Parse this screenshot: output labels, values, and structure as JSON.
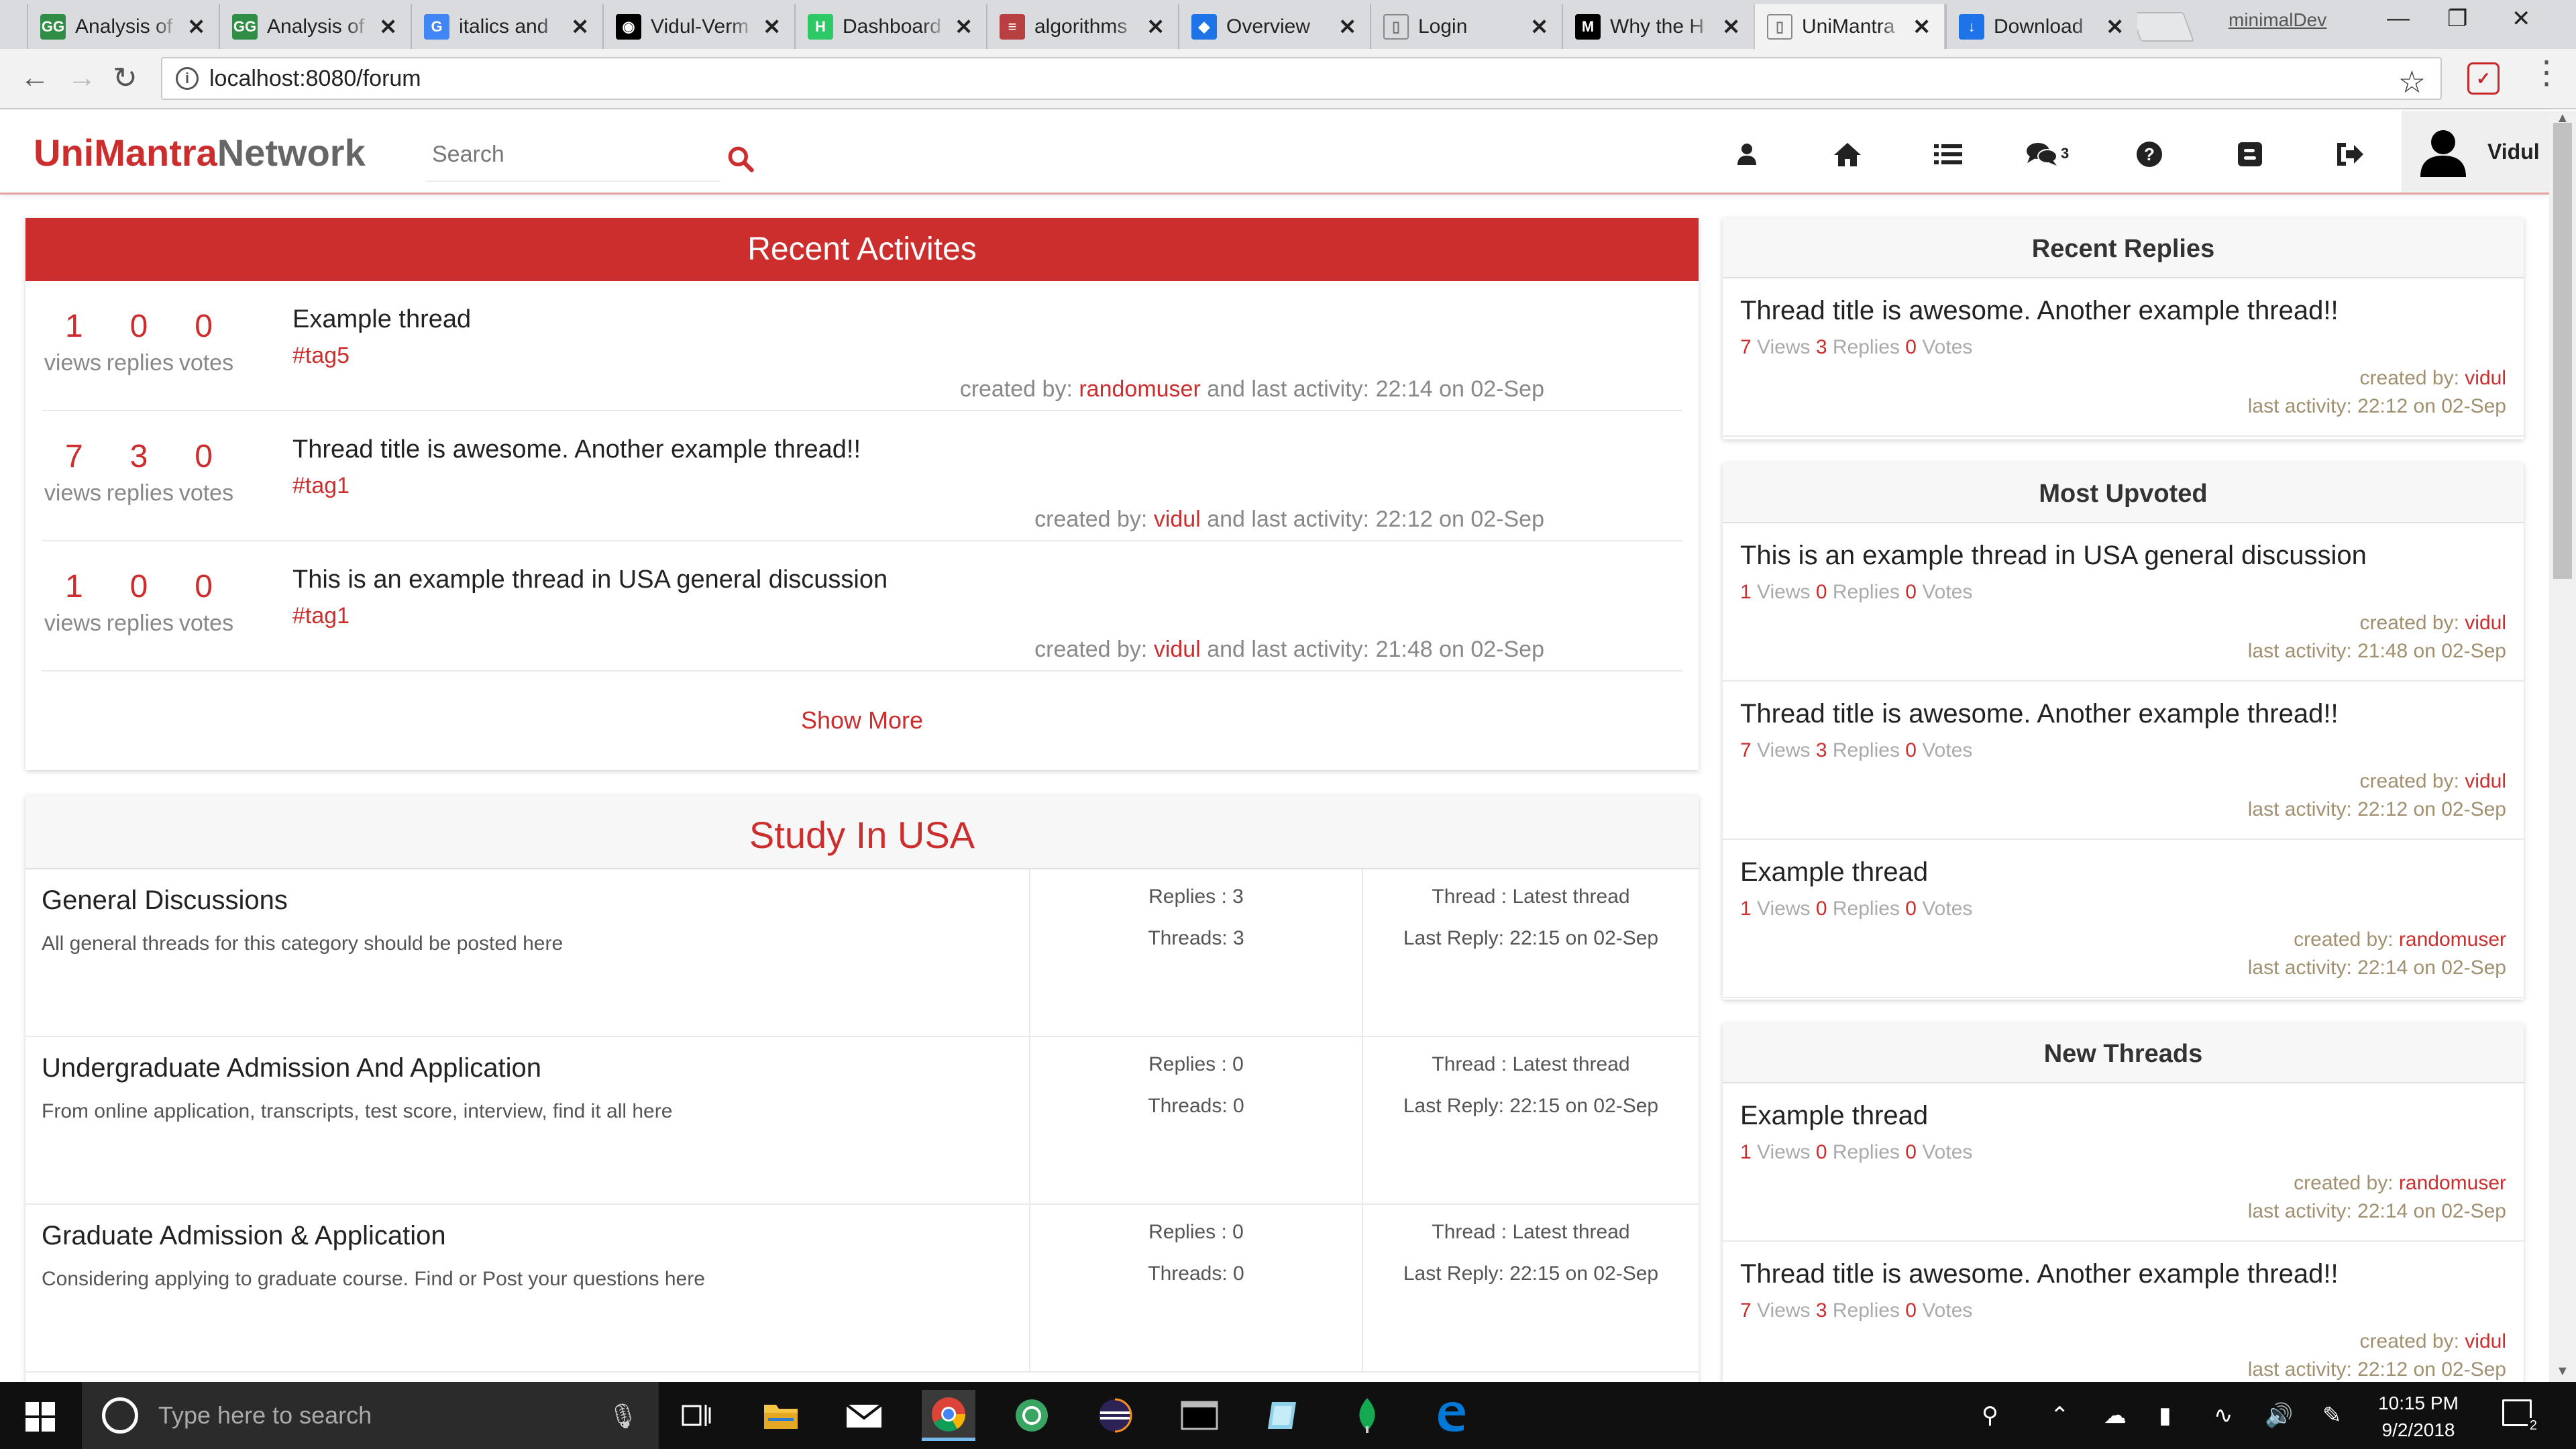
{
  "browser": {
    "tabs": [
      {
        "label": "Analysis of",
        "icon": "geeksforgeeks-icon",
        "color": "#2f8d46"
      },
      {
        "label": "Analysis of",
        "icon": "geeksforgeeks-icon",
        "color": "#2f8d46"
      },
      {
        "label": "italics and",
        "icon": "google-icon",
        "color": "#4285f4"
      },
      {
        "label": "Vidul-Verm",
        "icon": "github-icon",
        "color": "#000000"
      },
      {
        "label": "Dashboard",
        "icon": "hackerrank-icon",
        "color": "#2ec866"
      },
      {
        "label": "algorithms",
        "icon": "stackexchange-icon",
        "color": "#b84040"
      },
      {
        "label": "Overview",
        "icon": "shield-icon",
        "color": "#1e73e8"
      },
      {
        "label": "Login",
        "icon": "page-icon",
        "color": "#888888"
      },
      {
        "label": "Why the H",
        "icon": "medium-icon",
        "color": "#000000"
      },
      {
        "label": "UniMantra",
        "icon": "page-icon",
        "color": "#888888"
      },
      {
        "label": "Download",
        "icon": "download-icon",
        "color": "#1e73e8"
      }
    ],
    "profile_name": "minimalDev",
    "url": "localhost:8080/forum"
  },
  "site": {
    "brand_part1": "UniMantra",
    "brand_part2": "Network",
    "search_placeholder": "Search",
    "messages_count": "3",
    "user_name": "Vidul",
    "accent": "#cc2e2e"
  },
  "recent_activities": {
    "title": "Recent Activites",
    "labels": {
      "views": "views",
      "replies": "replies",
      "votes": "votes"
    },
    "items": [
      {
        "views": "1",
        "replies": "0",
        "votes": "0",
        "title": "Example thread",
        "tag": "#tag5",
        "created_prefix": "created by:",
        "user": "randomuser",
        "activity": "and last activity: 22:14 on 02-Sep"
      },
      {
        "views": "7",
        "replies": "3",
        "votes": "0",
        "title": "Thread title is awesome. Another example thread!!",
        "tag": "#tag1",
        "created_prefix": "created by:",
        "user": "vidul",
        "activity": "and last activity: 22:12 on 02-Sep"
      },
      {
        "views": "1",
        "replies": "0",
        "votes": "0",
        "title": "This is an example thread in USA general discussion",
        "tag": "#tag1",
        "created_prefix": "created by:",
        "user": "vidul",
        "activity": "and last activity: 21:48 on 02-Sep"
      }
    ],
    "show_more": "Show More"
  },
  "study_usa": {
    "title": "Study In USA",
    "categories": [
      {
        "name": "General Discussions",
        "desc": "All general threads for this category should be posted here",
        "replies": "Replies : 3",
        "threads": "Threads: 3",
        "thread": "Thread : Latest thread",
        "last_reply": "Last Reply: 22:15 on 02-Sep"
      },
      {
        "name": "Undergraduate Admission And Application",
        "desc": "From online application, transcripts, test score, interview, find it all here",
        "replies": "Replies : 0",
        "threads": "Threads: 0",
        "thread": "Thread : Latest thread",
        "last_reply": "Last Reply: 22:15 on 02-Sep"
      },
      {
        "name": "Graduate Admission & Application",
        "desc": "Considering applying to graduate course. Find or Post your questions here",
        "replies": "Replies : 0",
        "threads": "Threads: 0",
        "thread": "Thread : Latest thread",
        "last_reply": "Last Reply: 22:15 on 02-Sep"
      }
    ]
  },
  "recent_replies": {
    "title": "Recent Replies",
    "items": [
      {
        "title": "Thread title is awesome. Another example thread!!",
        "views": "7",
        "replies": "3",
        "votes": "0",
        "user": "vidul",
        "last_activity": "last activity: 22:12 on 02-Sep"
      }
    ]
  },
  "most_upvoted": {
    "title": "Most Upvoted",
    "items": [
      {
        "title": "This is an example thread in USA general discussion",
        "views": "1",
        "replies": "0",
        "votes": "0",
        "user": "vidul",
        "last_activity": "last activity: 21:48 on 02-Sep"
      },
      {
        "title": "Thread title is awesome. Another example thread!!",
        "views": "7",
        "replies": "3",
        "votes": "0",
        "user": "vidul",
        "last_activity": "last activity: 22:12 on 02-Sep"
      },
      {
        "title": "Example thread",
        "views": "1",
        "replies": "0",
        "votes": "0",
        "user": "randomuser",
        "last_activity": "last activity: 22:14 on 02-Sep"
      }
    ]
  },
  "new_threads": {
    "title": "New Threads",
    "items": [
      {
        "title": "Example thread",
        "views": "1",
        "replies": "0",
        "votes": "0",
        "user": "randomuser",
        "last_activity": "last activity: 22:14 on 02-Sep"
      },
      {
        "title": "Thread title is awesome. Another example thread!!",
        "views": "7",
        "replies": "3",
        "votes": "0",
        "user": "vidul",
        "last_activity": "last activity: 22:12 on 02-Sep"
      }
    ]
  },
  "stat_words": {
    "views": "Views",
    "replies": "Replies",
    "votes": "Votes",
    "created_by": "created by:"
  },
  "taskbar": {
    "search_placeholder": "Type here to search",
    "time": "10:15 PM",
    "date": "9/2/2018",
    "notification_count": "2"
  }
}
